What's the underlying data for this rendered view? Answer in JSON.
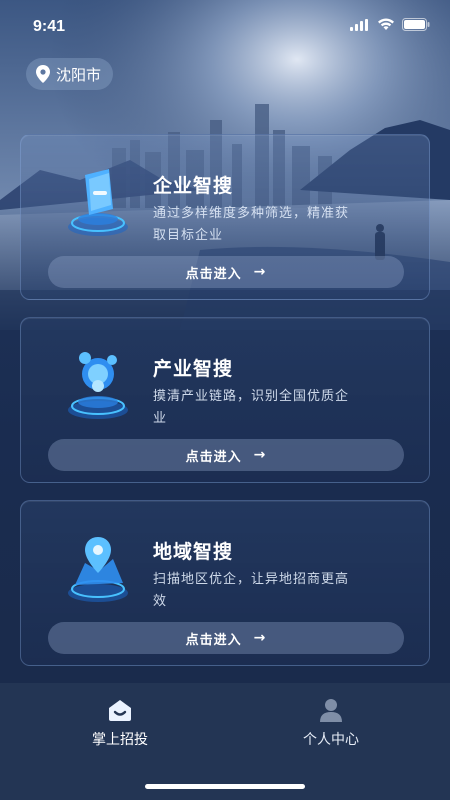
{
  "status_bar": {
    "time": "9:41"
  },
  "location": {
    "city": "沈阳市",
    "icon": "location-pin-icon"
  },
  "cards": [
    {
      "title": "企业智搜",
      "desc": "通过多样维度多种筛选，精准获取目标企业",
      "button": "点击进入",
      "icon": "enterprise-search-icon"
    },
    {
      "title": "产业智搜",
      "desc": "摸清产业链路，识别全国优质企业",
      "button": "点击进入",
      "icon": "industry-search-icon"
    },
    {
      "title": "地域智搜",
      "desc": "扫描地区优企，让异地招商更高效",
      "button": "点击进入",
      "icon": "region-search-icon"
    }
  ],
  "tabs": [
    {
      "label": "掌上招投",
      "icon": "home-icon",
      "active": true
    },
    {
      "label": "个人中心",
      "icon": "user-icon",
      "active": false
    }
  ],
  "colors": {
    "background": "#1c2b48",
    "accent": "#3aa7ff",
    "tab_bar": "#233554"
  }
}
